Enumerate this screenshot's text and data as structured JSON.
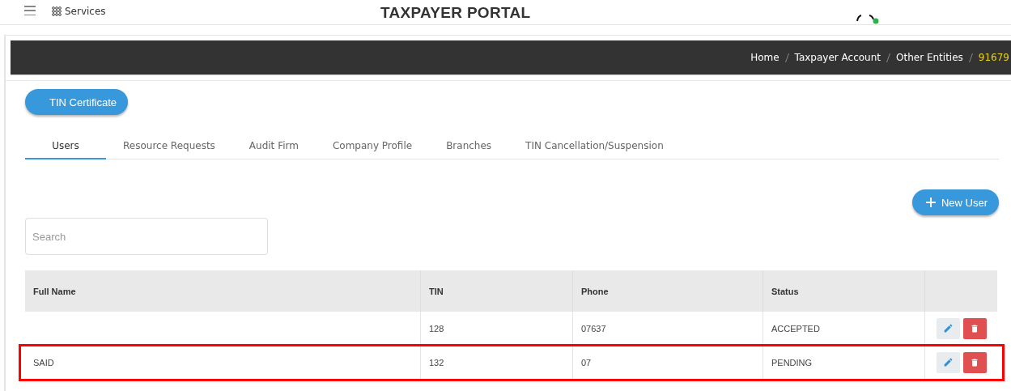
{
  "header": {
    "services_label": "Services",
    "title": "TAXPAYER PORTAL"
  },
  "breadcrumb": [
    {
      "label": "Home",
      "current": false
    },
    {
      "label": "Taxpayer Account",
      "current": false
    },
    {
      "label": "Other Entities",
      "current": false
    },
    {
      "label": "91679",
      "current": true
    }
  ],
  "certificate_button": "TIN Certificate",
  "tabs": [
    {
      "label": "Users",
      "selected": true
    },
    {
      "label": "Resource Requests",
      "selected": false
    },
    {
      "label": "Audit Firm",
      "selected": false
    },
    {
      "label": "Company Profile",
      "selected": false
    },
    {
      "label": "Branches",
      "selected": false
    },
    {
      "label": "TIN Cancellation/Suspension",
      "selected": false
    }
  ],
  "new_user_button": "New User",
  "search": {
    "placeholder": "Search"
  },
  "table": {
    "columns": [
      "Full Name",
      "TIN",
      "Phone",
      "Status"
    ],
    "rows": [
      {
        "cells": [
          "",
          "128",
          "07637",
          "ACCEPTED"
        ],
        "highlighted": false
      },
      {
        "cells": [
          "SAID",
          "132",
          "07",
          "PENDING"
        ],
        "highlighted": true
      }
    ]
  }
}
